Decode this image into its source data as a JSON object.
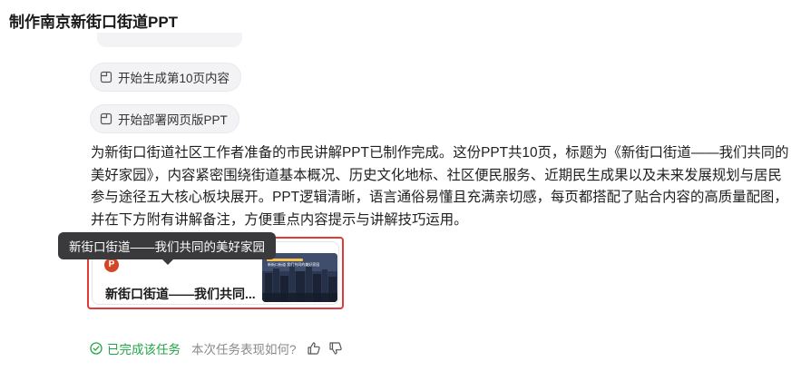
{
  "chat": {
    "title": "制作南京新街口街道PPT"
  },
  "steps": [
    {
      "label": "开始生成第10页内容",
      "icon": "document-icon"
    },
    {
      "label": "开始部署网页版PPT",
      "icon": "document-icon"
    }
  ],
  "message": {
    "text": "为新街口街道社区工作者准备的市民讲解PPT已制作完成。这份PPT共10页，标题为《新街口街道——我们共同的美好家园》，内容紧密围绕街道基本概况、历史文化地标、社区便民服务、近期民生成果以及未来发展规划与居民参与途径五大核心板块展开。PPT逻辑清晰，语言通俗易懂且充满亲切感，每页都搭配了贴合内容的高质量配图，并在下方附有讲解备注，方便重点内容提示与讲解技巧运用。"
  },
  "tooltip": {
    "text": "新街口街道——我们共同的美好家园"
  },
  "ppt_card": {
    "title": "新街口街道——我们共同...",
    "file_icon": "powerpoint-icon",
    "thumbnail": {
      "heading": "新街口街道 我们共同的美好家园"
    }
  },
  "footer": {
    "status": "已完成该任务",
    "rating_prompt": "本次任务表现如何?",
    "colors": {
      "success": "#22a447",
      "muted": "#8a8a8a",
      "highlight": "#e03a3a"
    }
  }
}
